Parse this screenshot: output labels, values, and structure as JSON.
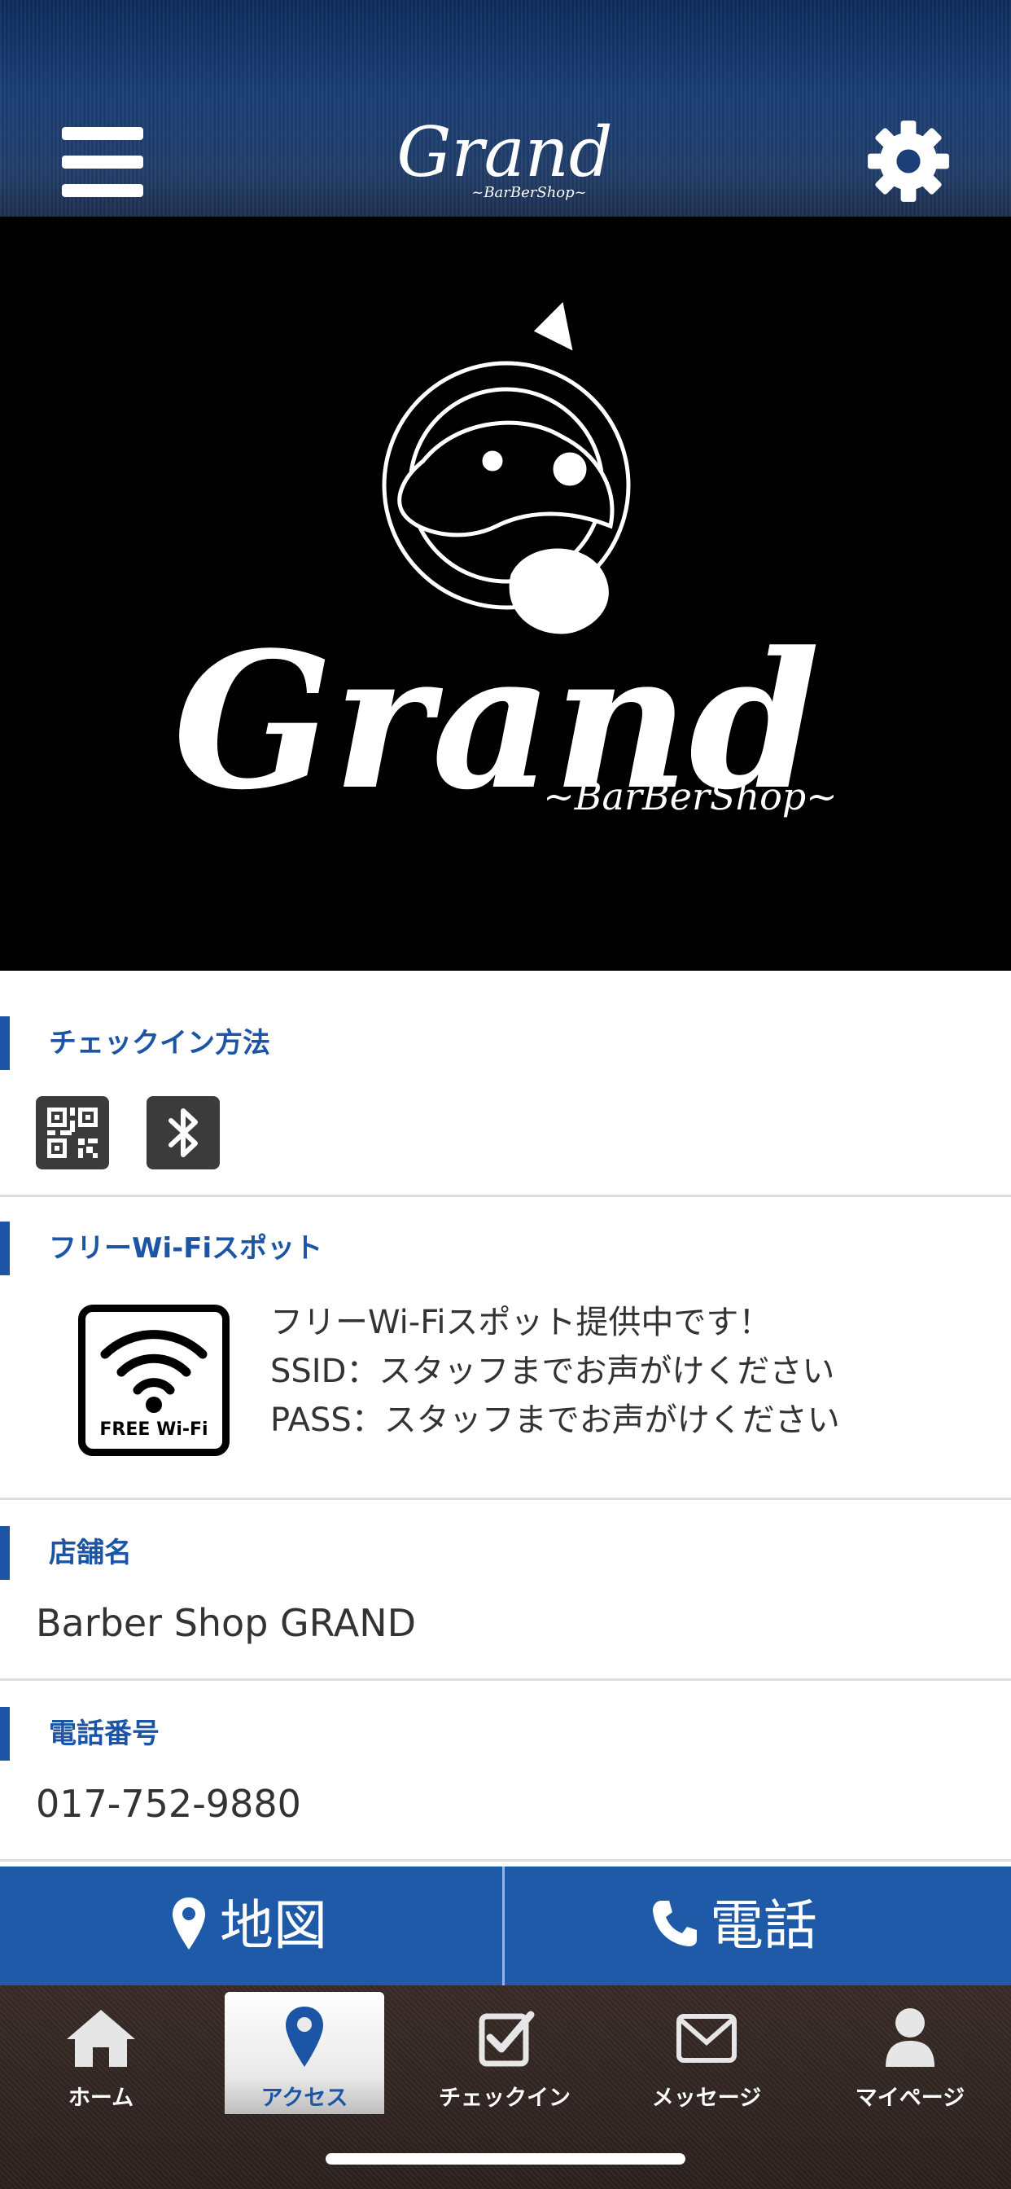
{
  "header": {
    "logo_text": "Grand",
    "logo_subtext": "~BarBerShop~"
  },
  "hero": {
    "logo_text": "Grand",
    "logo_subtext": "~BarBerShop~"
  },
  "checkin_method": {
    "title": "チェックイン方法",
    "methods": [
      "qr-code-icon",
      "bluetooth-icon"
    ]
  },
  "wifi": {
    "title": "フリーWi-Fiスポット",
    "badge_text": "FREE Wi-Fi",
    "lines": [
      "フリーWi-Fiスポット提供中です！",
      "SSID：スタッフまでお声がけください",
      "PASS：スタッフまでお声がけください"
    ]
  },
  "store": {
    "title": "店舗名",
    "value": "Barber Shop GRAND"
  },
  "phone": {
    "title": "電話番号",
    "value": "017-752-9880"
  },
  "actions": {
    "map_label": "地図",
    "call_label": "電話"
  },
  "tabs": [
    {
      "label": "ホーム",
      "icon": "home-icon",
      "active": false
    },
    {
      "label": "アクセス",
      "icon": "map-pin-icon",
      "active": true
    },
    {
      "label": "チェックイン",
      "icon": "checkbox-icon",
      "active": false
    },
    {
      "label": "メッセージ",
      "icon": "envelope-icon",
      "active": false
    },
    {
      "label": "マイページ",
      "icon": "user-icon",
      "active": false
    }
  ],
  "colors": {
    "accent": "#1c55a6",
    "action_bar": "#1f5aa9",
    "hero_bg": "#000000"
  }
}
